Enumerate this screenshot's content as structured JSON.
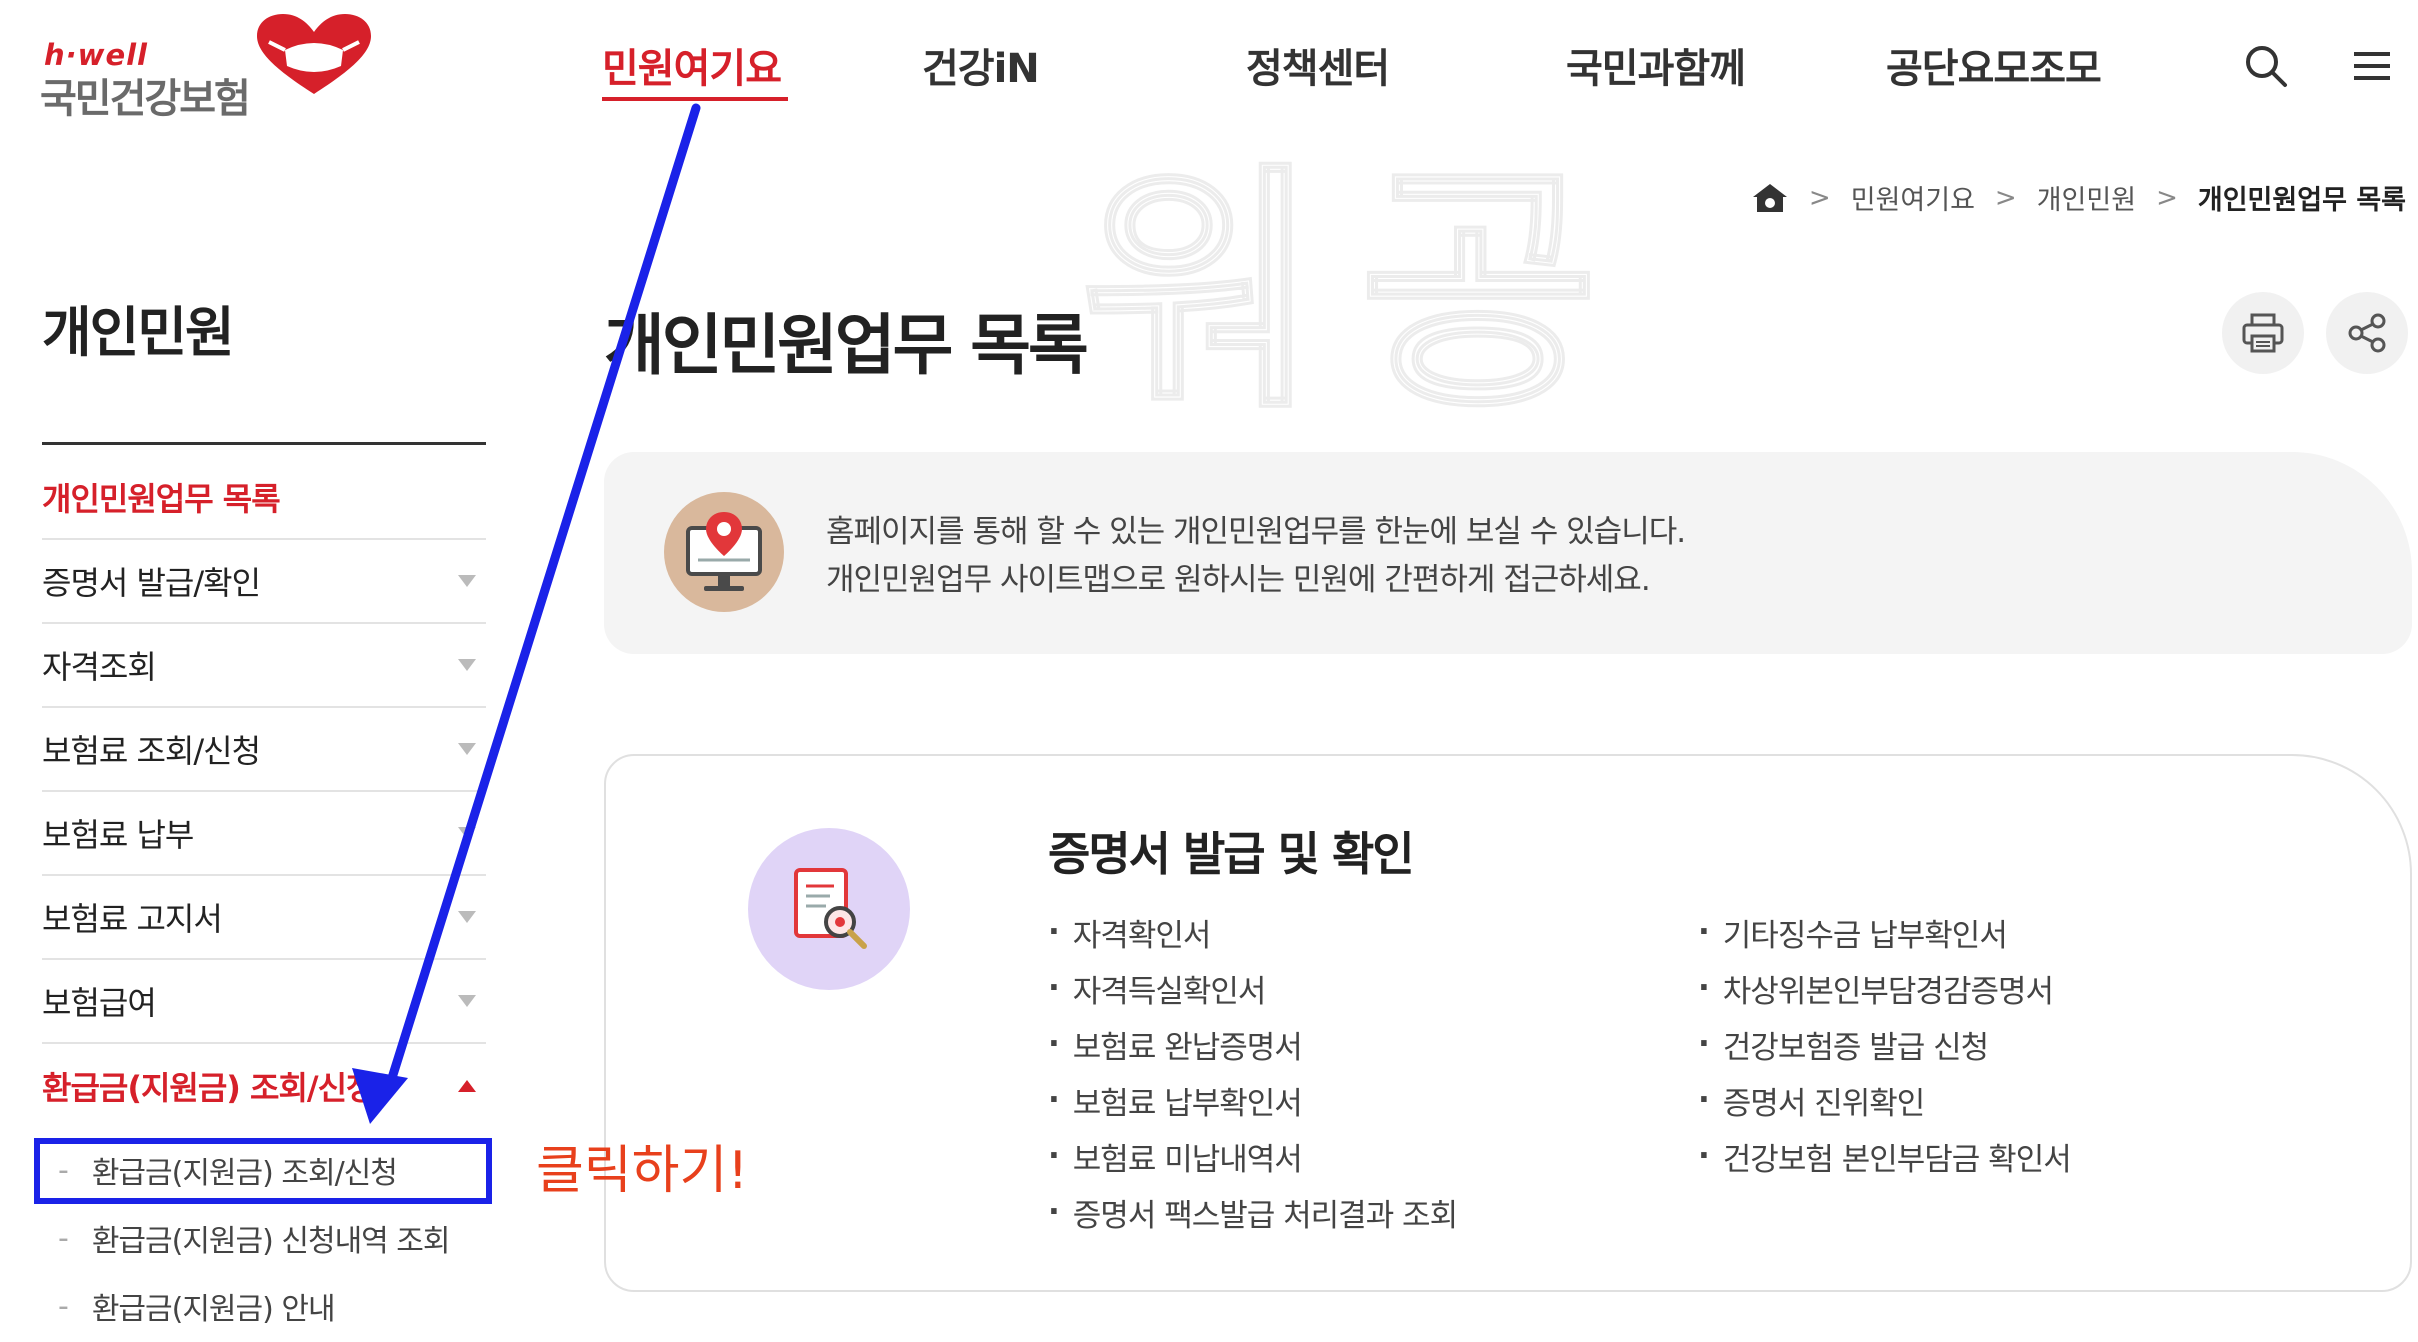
{
  "logo": {
    "small_text": "h·well",
    "main_text": "국민건강보험"
  },
  "gnb": {
    "items": [
      {
        "label": "민원여기요",
        "active": true
      },
      {
        "label": "건강iN",
        "active": false
      },
      {
        "label": "정책센터",
        "active": false
      },
      {
        "label": "국민과함께",
        "active": false
      },
      {
        "label": "공단요모조모",
        "active": false
      }
    ]
  },
  "watermark": "워공",
  "breadcrumb": {
    "items": [
      "민원여기요",
      "개인민원",
      "개인민원업무 목록"
    ]
  },
  "sidebar": {
    "title": "개인민원",
    "items": [
      {
        "label": "개인민원업무 목록",
        "active": true,
        "caret": "none"
      },
      {
        "label": "증명서 발급/확인",
        "active": false,
        "caret": "down"
      },
      {
        "label": "자격조회",
        "active": false,
        "caret": "down"
      },
      {
        "label": "보험료 조회/신청",
        "active": false,
        "caret": "down"
      },
      {
        "label": "보험료 납부",
        "active": false,
        "caret": "down"
      },
      {
        "label": "보험료 고지서",
        "active": false,
        "caret": "down"
      },
      {
        "label": "보험급여",
        "active": false,
        "caret": "down"
      },
      {
        "label": "환급금(지원금) 조회/신청",
        "active": true,
        "caret": "up"
      }
    ],
    "sub_items": [
      {
        "label": "환급금(지원금) 조회/신청"
      },
      {
        "label": "환급금(지원금) 신청내역 조회"
      },
      {
        "label": "환급금(지원금) 안내"
      }
    ]
  },
  "annotation": {
    "click_text": "클릭하기!",
    "arrow_color": "#1a22e8",
    "text_color": "#e8401c"
  },
  "main": {
    "title": "개인민원업무 목록",
    "info": {
      "line1": "홈페이지를 통해 할 수 있는 개인민원업무를 한눈에 보실 수 있습니다.",
      "line2": "개인민원업무 사이트맵으로 원하시는 민원에 간편하게 접근하세요."
    },
    "card": {
      "title": "증명서 발급 및 확인",
      "left_items": [
        "자격확인서",
        "자격득실확인서",
        "보험료 완납증명서",
        "보험료 납부확인서",
        "보험료 미납내역서",
        "증명서 팩스발급 처리결과 조회"
      ],
      "right_items": [
        "기타징수금 납부확인서",
        "차상위본인부담경감증명서",
        "건강보험증 발급 신청",
        "증명서 진위확인",
        "건강보험 본인부담금 확인서"
      ]
    }
  },
  "colors": {
    "brand_red": "#d6202a",
    "text": "#222222",
    "muted": "#444444",
    "light_bg": "#f4f4f4",
    "card_icon_bg": "#e0d4f7"
  },
  "icons": [
    "search-icon",
    "hamburger-menu-icon",
    "home-icon",
    "print-icon",
    "share-icon",
    "monitor-location-icon",
    "document-search-icon"
  ]
}
